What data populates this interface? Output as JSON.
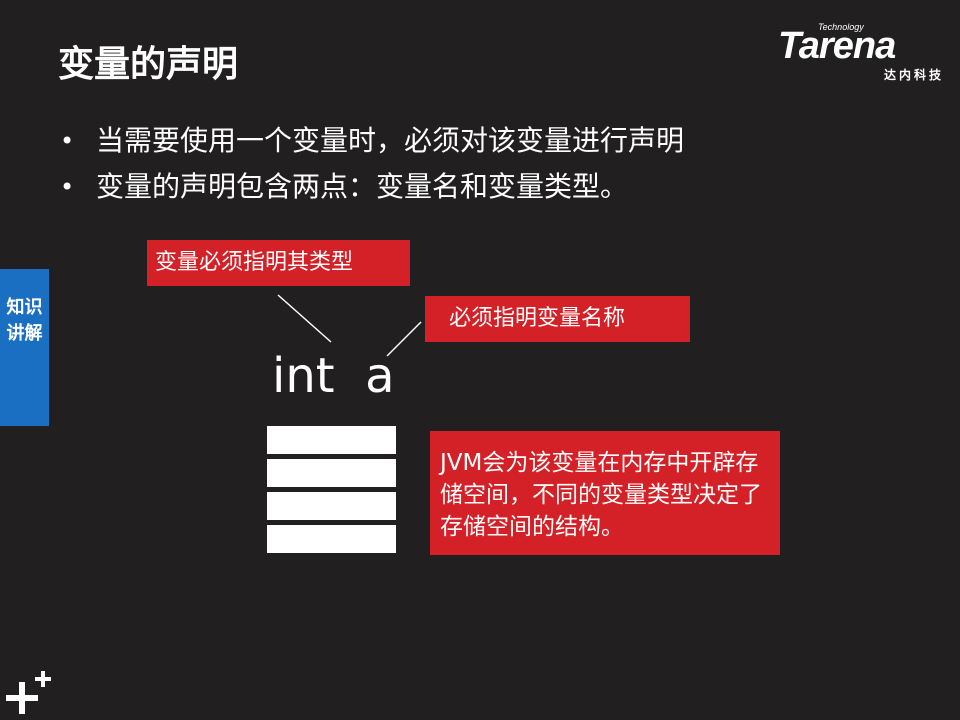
{
  "slide": {
    "title": "变量的声明",
    "bullets": [
      "当需要使用一个变量时，必须对该变量进行声明",
      "变量的声明包含两点：变量名和变量类型。"
    ]
  },
  "logo": {
    "tagline": "Technology",
    "name": "Tarena",
    "subtitle": "达内科技"
  },
  "side_tab": {
    "label": "知识讲解"
  },
  "diagram": {
    "code": "int  a",
    "callout_type": "变量必须指明其类型",
    "callout_name": "必须指明变量名称",
    "callout_jvm": "JVM会为该变量在内存中开辟存储空间，不同的变量类型决定了存储空间的结构。"
  },
  "colors": {
    "background": "#221f20",
    "callout": "#d42127",
    "side_tab": "#1a6fc2",
    "text": "#ffffff"
  },
  "icons": {
    "corner": "plus-icon"
  }
}
